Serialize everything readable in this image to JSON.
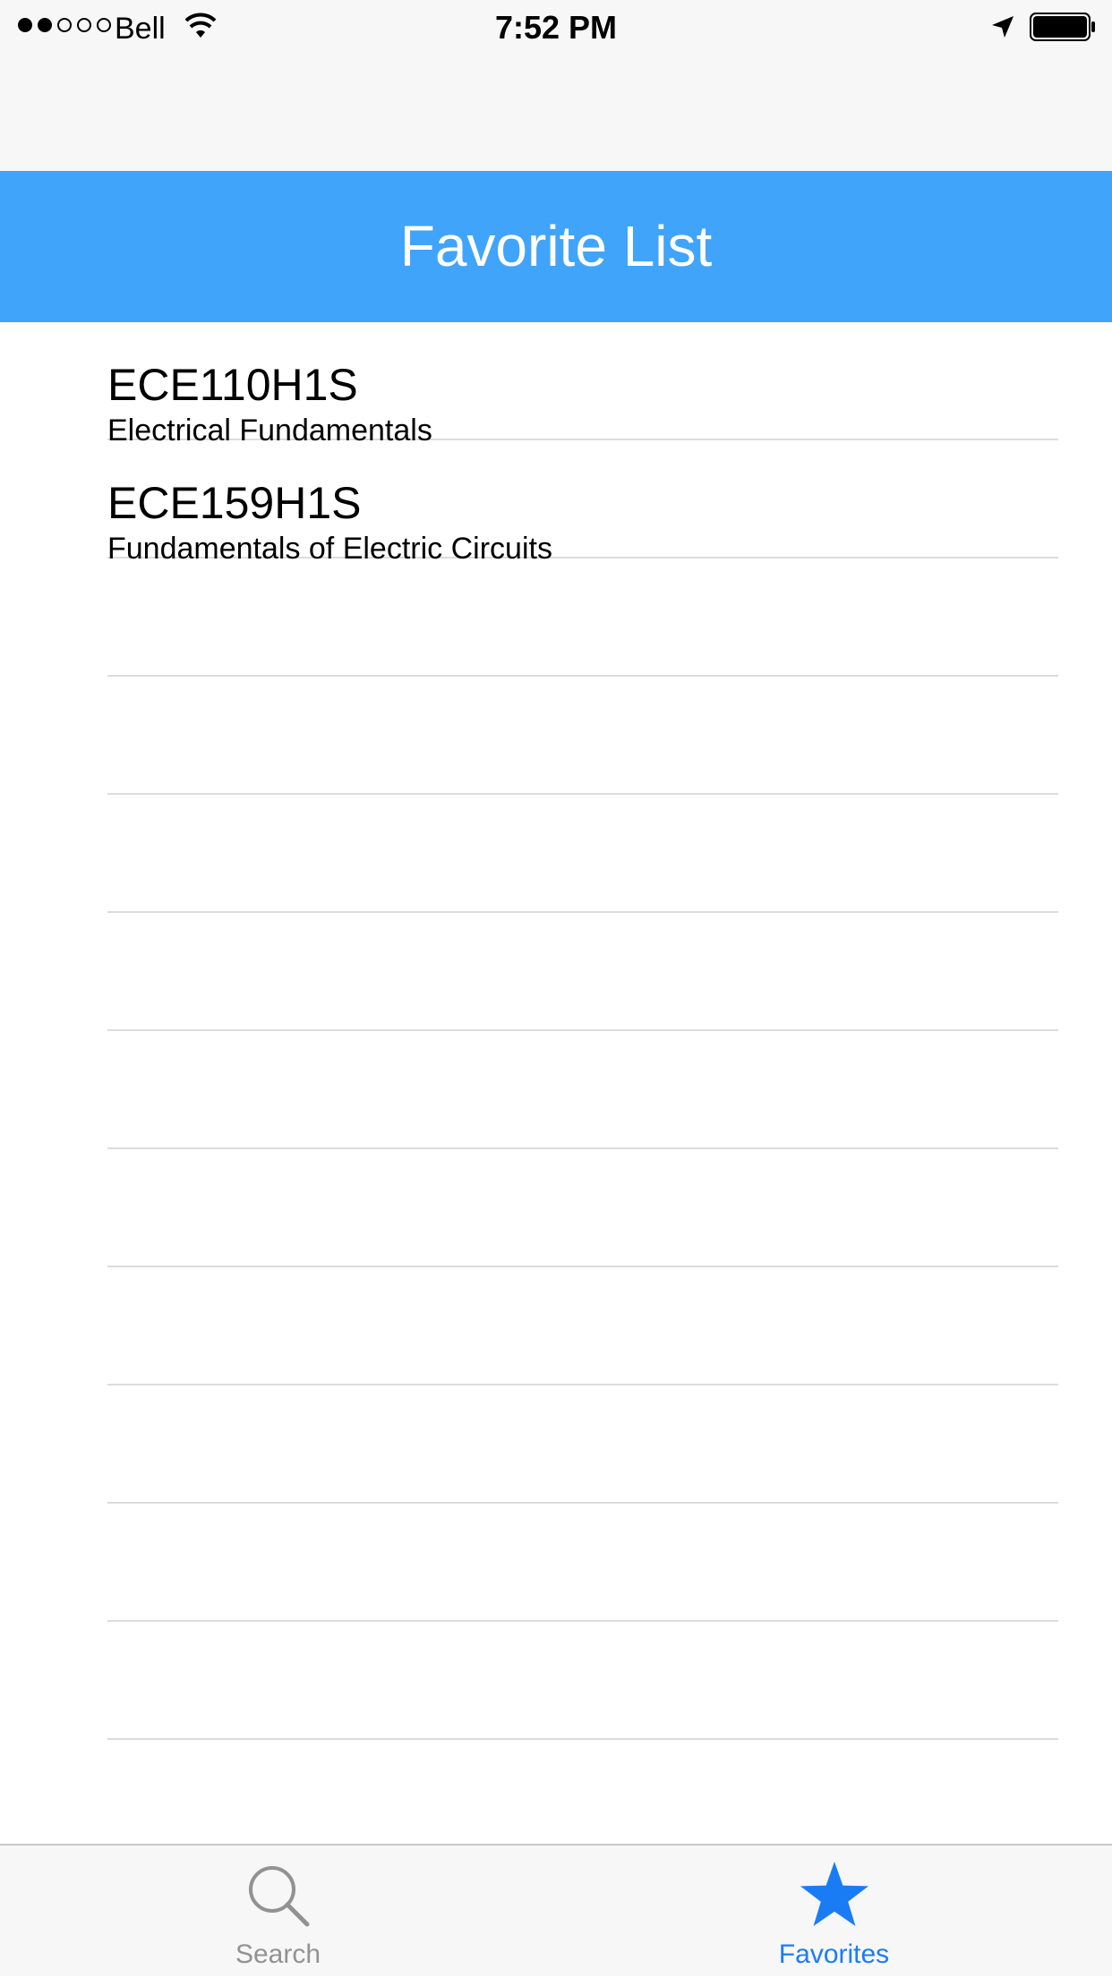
{
  "status_bar": {
    "carrier": "Bell",
    "time": "7:52 PM",
    "signal_bars_filled": 2,
    "signal_bars_total": 5
  },
  "header": {
    "title": "Favorite List",
    "background_color": "#40a4fa"
  },
  "favorites": [
    {
      "code": "ECE110H1S",
      "name": "Electrical Fundamentals"
    },
    {
      "code": "ECE159H1S",
      "name": "Fundamentals of Electric Circuits"
    },
    {
      "code": "",
      "name": ""
    },
    {
      "code": "",
      "name": ""
    },
    {
      "code": "",
      "name": ""
    },
    {
      "code": "",
      "name": ""
    },
    {
      "code": "",
      "name": ""
    },
    {
      "code": "",
      "name": ""
    },
    {
      "code": "",
      "name": ""
    },
    {
      "code": "",
      "name": ""
    },
    {
      "code": "",
      "name": ""
    },
    {
      "code": "",
      "name": ""
    }
  ],
  "tab_bar": {
    "tabs": [
      {
        "label": "Search",
        "icon": "search-icon",
        "selected": false
      },
      {
        "label": "Favorites",
        "icon": "star-icon",
        "selected": true
      }
    ],
    "active_color": "#1a7cf5",
    "inactive_color": "#929292"
  }
}
